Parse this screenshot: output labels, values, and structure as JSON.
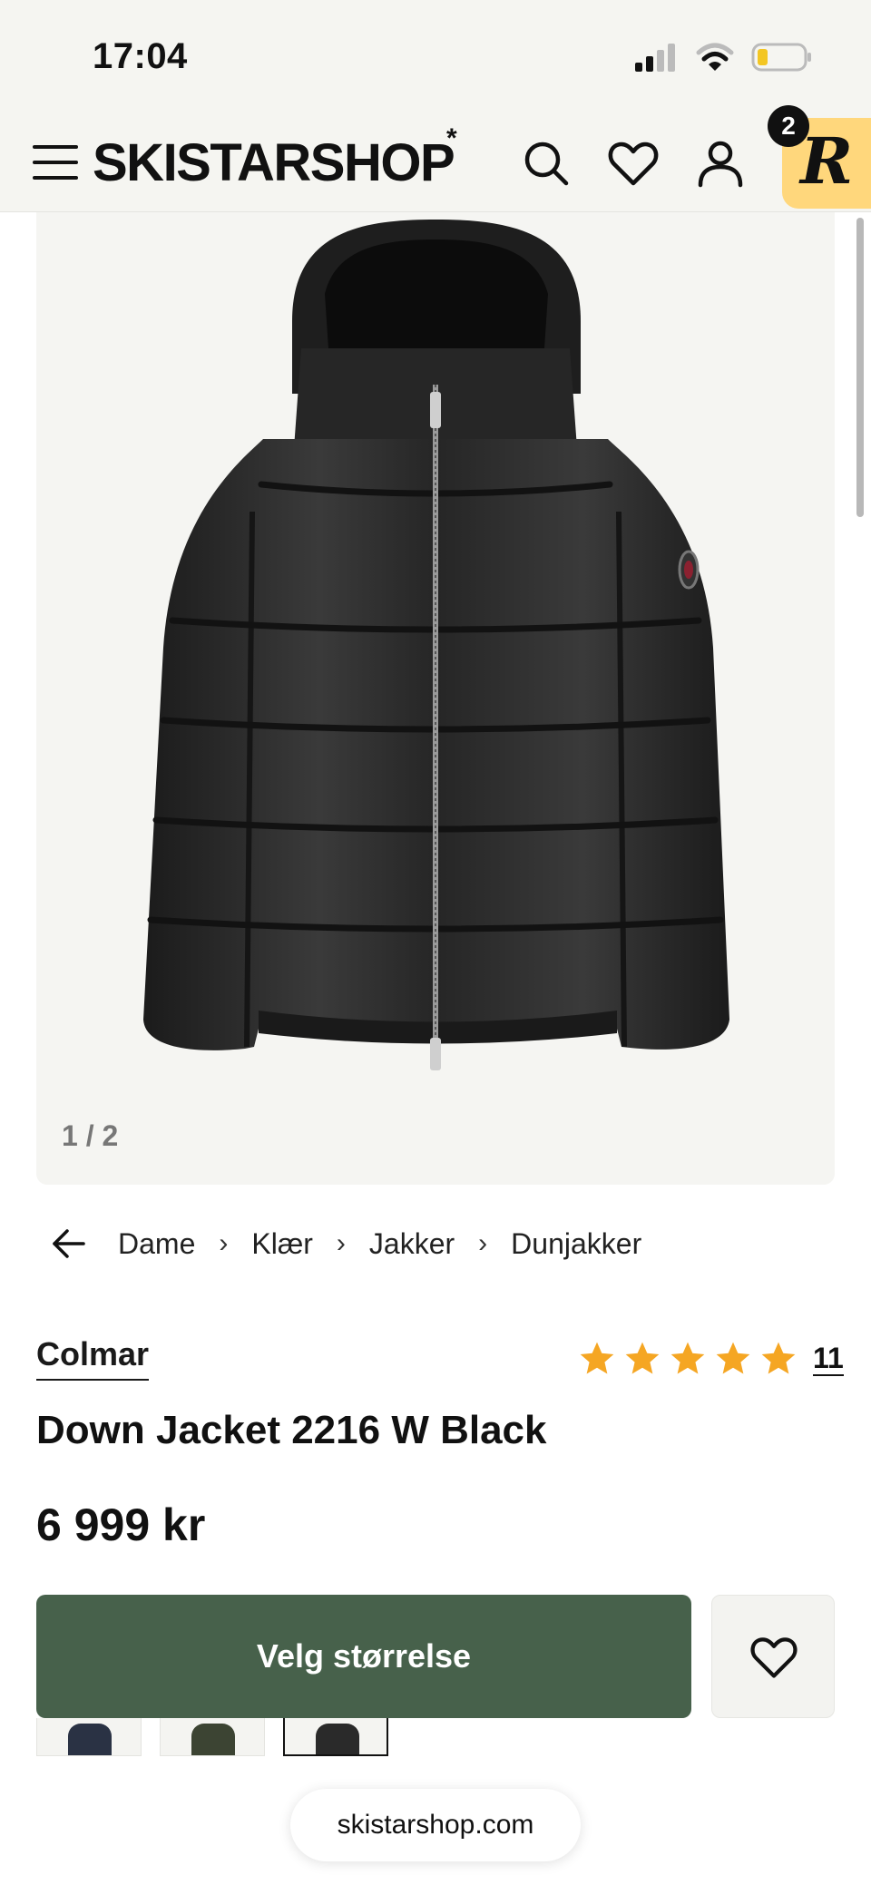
{
  "status_bar": {
    "time": "17:04"
  },
  "header": {
    "logo": "SKISTARSHOP",
    "logo_mark": "*",
    "badge_letter": "R",
    "badge_count": "2"
  },
  "gallery": {
    "counter": "1 / 2"
  },
  "breadcrumb": {
    "items": [
      "Dame",
      "Klær",
      "Jakker",
      "Dunjakker"
    ]
  },
  "product": {
    "brand": "Colmar",
    "title": "Down Jacket 2216 W Black",
    "price": "6 999 kr",
    "rating_stars": 5,
    "rating_count": "11"
  },
  "cta": {
    "label": "Velg størrelse"
  },
  "browser": {
    "url": "skistarshop.com"
  },
  "colors": {
    "accent_green": "#47614b",
    "star": "#f5a623",
    "badge_yellow": "#ffd77c"
  }
}
